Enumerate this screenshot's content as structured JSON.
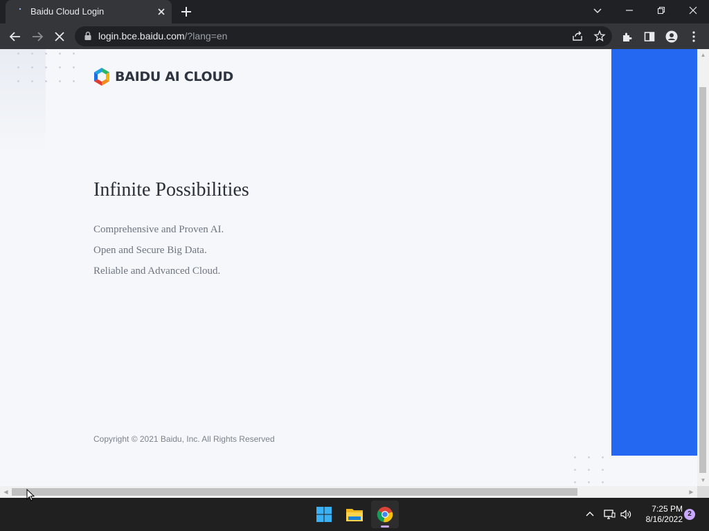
{
  "browser": {
    "tab": {
      "title": "Baidu Cloud Login",
      "favicon": "page-loading-icon"
    },
    "url": {
      "host": "login.bce.baidu.com",
      "path": "/?lang=en"
    }
  },
  "page": {
    "logo_text": "BAIDU AI CLOUD",
    "headline": "Infinite Possibilities",
    "features": [
      "Comprehensive and Proven AI.",
      "Open and Secure Big Data.",
      "Reliable and Advanced Cloud."
    ],
    "copyright": "Copyright © 2021 Baidu, Inc. All Rights Reserved",
    "accent_color": "#2468f2"
  },
  "taskbar": {
    "apps": [
      "start-icon",
      "file-explorer-icon",
      "chrome-icon"
    ],
    "time": "7:25 PM",
    "date": "8/16/2022",
    "notification_count": "2"
  }
}
